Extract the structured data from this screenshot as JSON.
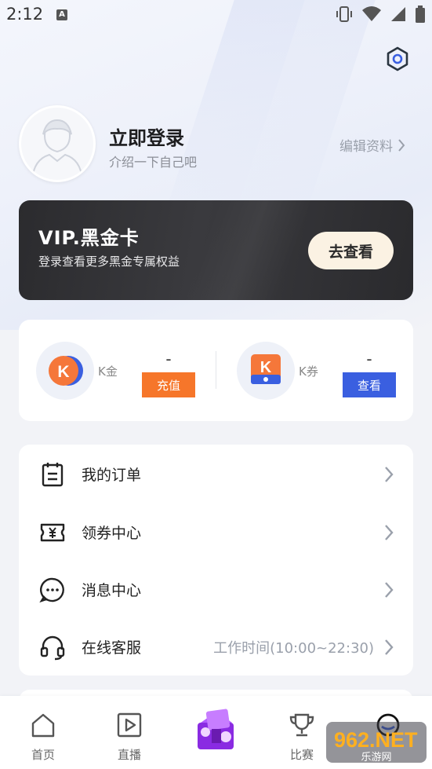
{
  "status": {
    "time": "2:12",
    "notif_letter": "A"
  },
  "profile": {
    "title": "立即登录",
    "subtitle": "介绍一下自己吧",
    "edit_label": "编辑资料"
  },
  "vip": {
    "title": "VIP.黑金卡",
    "subtitle": "登录查看更多黑金专属权益",
    "button": "去查看"
  },
  "wallet": {
    "kgold": {
      "label": "K金",
      "value": "-",
      "button": "充值",
      "button_color": "#f6762a"
    },
    "kcoupon": {
      "label": "K券",
      "value": "-",
      "button": "查看",
      "button_color": "#3a5fe0"
    }
  },
  "menu": [
    {
      "label": "我的订单",
      "icon": "clipboard-icon",
      "extra": ""
    },
    {
      "label": "领券中心",
      "icon": "ticket-yen-icon",
      "extra": ""
    },
    {
      "label": "消息中心",
      "icon": "chat-bubble-icon",
      "extra": ""
    },
    {
      "label": "在线客服",
      "icon": "headset-icon",
      "extra": "工作时间(10:00~22:30)"
    }
  ],
  "tabs": [
    {
      "label": "首页",
      "icon": "home-icon"
    },
    {
      "label": "直播",
      "icon": "play-icon"
    },
    {
      "label": "",
      "icon": "promo-badge-icon"
    },
    {
      "label": "比赛",
      "icon": "trophy-icon"
    },
    {
      "label": "",
      "icon": "profile-icon"
    }
  ],
  "watermark": {
    "text": "962.NET",
    "subtext": "乐游网"
  },
  "colors": {
    "accent_orange": "#f6762a",
    "accent_blue": "#3a5fe0",
    "vip_dark": "#2b2b2e",
    "vip_button": "#fbf2e3"
  }
}
